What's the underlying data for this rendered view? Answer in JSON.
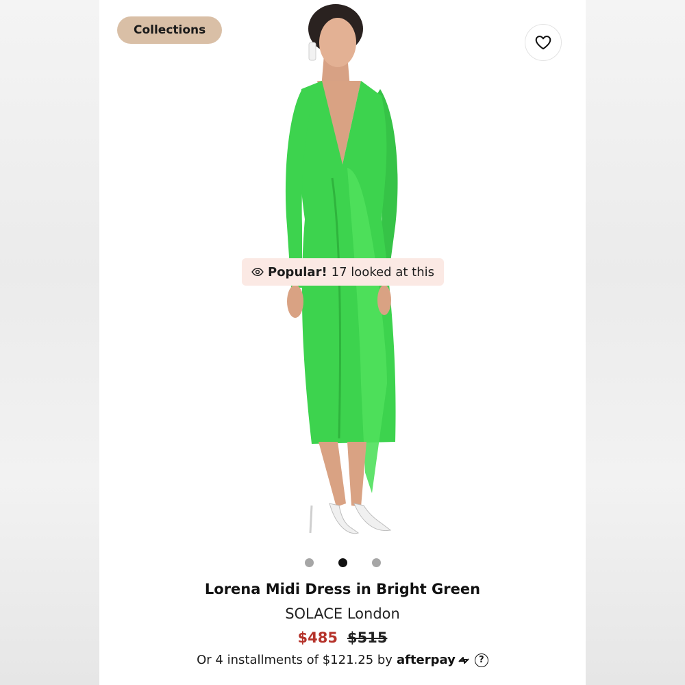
{
  "header": {
    "collections_label": "Collections",
    "favorite_icon": "heart-icon"
  },
  "badge": {
    "icon": "eye-icon",
    "popular_label": "Popular!",
    "viewers_text": "17 looked at this"
  },
  "carousel": {
    "total": 3,
    "active_index": 1
  },
  "product": {
    "title": "Lorena Midi Dress in Bright Green",
    "brand": "SOLACE London",
    "price_sale": "$485",
    "price_original": "$515",
    "installments_text": "Or 4 installments of $121.25 by",
    "payment_provider": "afterpay",
    "help_icon_glyph": "?"
  },
  "colors": {
    "dress_green": "#3dd34e",
    "sale_red": "#b5322a",
    "pill_tan": "#d9bfa6",
    "badge_pink": "#fbe9e4"
  }
}
